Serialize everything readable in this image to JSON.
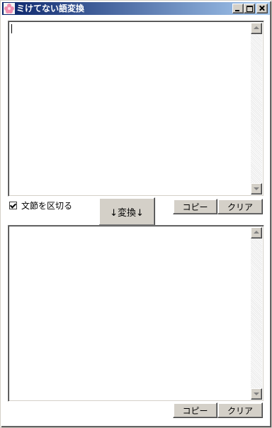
{
  "window": {
    "title": "ミけてない語変換"
  },
  "input_area": {
    "value": ""
  },
  "options": {
    "split_phrases_label": "文節を区切る",
    "split_phrases_checked": true
  },
  "buttons": {
    "convert": "↓変換↓",
    "copy": "コピー",
    "clear": "クリア"
  },
  "output_area": {
    "value": ""
  },
  "colors": {
    "titlebar_start": "#0a246a",
    "titlebar_end": "#a6caf0",
    "button_face": "#d4d0c8"
  }
}
